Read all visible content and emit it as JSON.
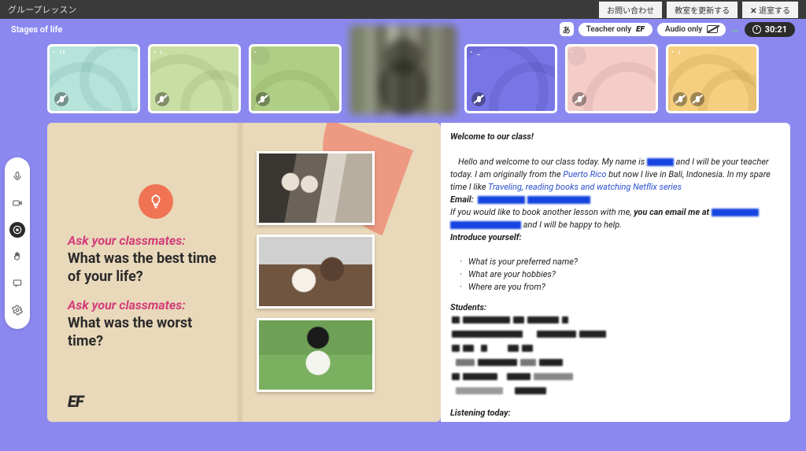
{
  "top": {
    "title": "グループレッスン",
    "contact": "お問い合わせ",
    "refresh": "教室を更新する",
    "leave": "退室する"
  },
  "sub": {
    "lesson_title": "Stages of life",
    "teacher_only": "Teacher only",
    "audio_only": "Audio only",
    "live": "…",
    "timer": "30:21",
    "lang_badge": "あ"
  },
  "slide": {
    "ask1": "Ask your classmates:",
    "q1": "What was the best time of your life?",
    "ask2": "Ask your classmates:",
    "q2": "What was the worst time?",
    "logo": "EF"
  },
  "notes": {
    "welcome_title": "Welcome to our class!",
    "intro_1": "Hello and welcome to our class today. My name is ",
    "intro_2": " and I will be your teacher today. I am originally from the ",
    "link_country": "Puerto Rico",
    "intro_3": " but now I live in Bali, Indonesia. In my spare time I like ",
    "link_hobby": "Traveling, reading books and watching Netflix series",
    "email_label": "Email:",
    "book_1": "If you would like to book another lesson with me, ",
    "book_bold": "you can email me at ",
    "book_2": " and I will be happy to help.",
    "introduce": "Introduce yourself:",
    "q_name": "What is your preferred name?",
    "q_hobbies": "What are your hobbies?",
    "q_from": "Where are you from?",
    "students_heading": "Students:",
    "listening_heading": "Listening today:"
  }
}
